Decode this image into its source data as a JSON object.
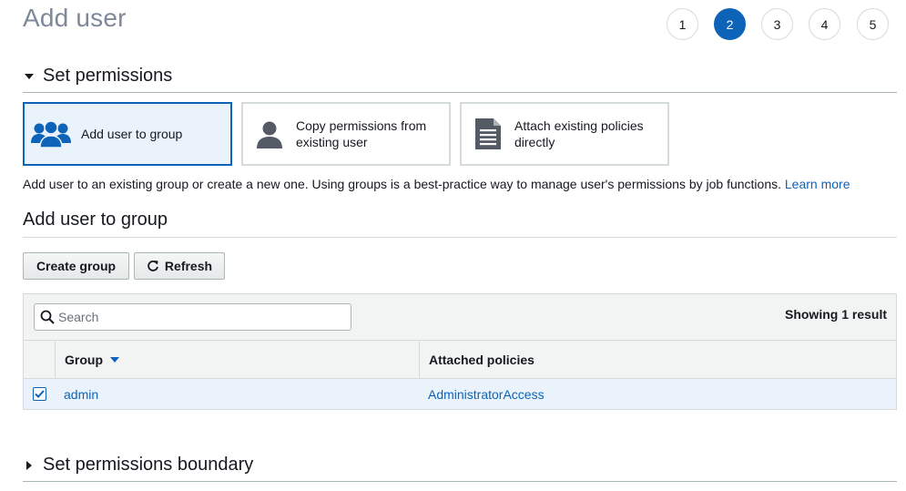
{
  "page": {
    "title": "Add user"
  },
  "stepper": {
    "steps": [
      "1",
      "2",
      "3",
      "4",
      "5"
    ],
    "active_step": "2",
    "active_color": "#0d63b8"
  },
  "permissions_section": {
    "title": "Set permissions",
    "expanded": true,
    "options": [
      {
        "label": "Add user to group",
        "icon": "users-group-icon",
        "selected": true
      },
      {
        "label": "Copy permissions from existing user",
        "icon": "user-icon",
        "selected": false
      },
      {
        "label": "Attach existing policies directly",
        "icon": "document-icon",
        "selected": false
      }
    ],
    "description": "Add user to an existing group or create a new one. Using groups is a best-practice way to manage user's permissions by job functions.",
    "learn_more": "Learn more"
  },
  "group_section": {
    "title": "Add user to group",
    "create_group_label": "Create group",
    "refresh_label": "Refresh",
    "search_placeholder": "Search",
    "result_count": "Showing 1 result",
    "columns": {
      "group": "Group",
      "policies": "Attached policies"
    },
    "sort_column": "Group",
    "rows": [
      {
        "checked": true,
        "group": "admin",
        "policies": "AdministratorAccess"
      }
    ]
  },
  "boundary_section": {
    "title": "Set permissions boundary",
    "expanded": false
  },
  "colors": {
    "accent": "#0d63b8",
    "selected_bg": "#eaf3fb",
    "title_gray": "#7d8998",
    "icon_gray": "#545b64"
  }
}
